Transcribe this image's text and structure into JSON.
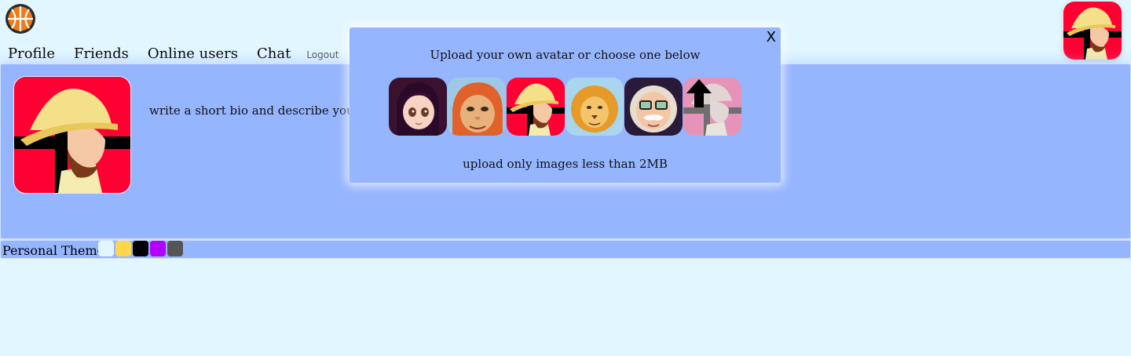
{
  "header": {
    "logo_icon": "basketball-logo-icon",
    "nav": {
      "profile": "Profile",
      "friends": "Friends",
      "online_users": "Online users",
      "chat": "Chat",
      "logout": "Logout"
    },
    "current_avatar": "explorer-avatar"
  },
  "profile": {
    "avatar": "explorer-avatar",
    "bio_placeholder": "write a short bio and describe yourself"
  },
  "theme": {
    "label": "Personal Theme",
    "swatches": [
      "#e2f6ff",
      "#ffd54a",
      "#000000",
      "#b400ff",
      "#555555"
    ]
  },
  "avatar_modal": {
    "close_label": "X",
    "title": "Upload your own avatar or choose one below",
    "choices": [
      "girl-avatar",
      "old-woman-avatar",
      "explorer-avatar",
      "lion-avatar",
      "old-man-glasses-avatar",
      "upload-avatar"
    ],
    "note": "upload only images less than 2MB"
  },
  "colors": {
    "background": "#e2f6ff",
    "panel": "#96b5ff"
  }
}
